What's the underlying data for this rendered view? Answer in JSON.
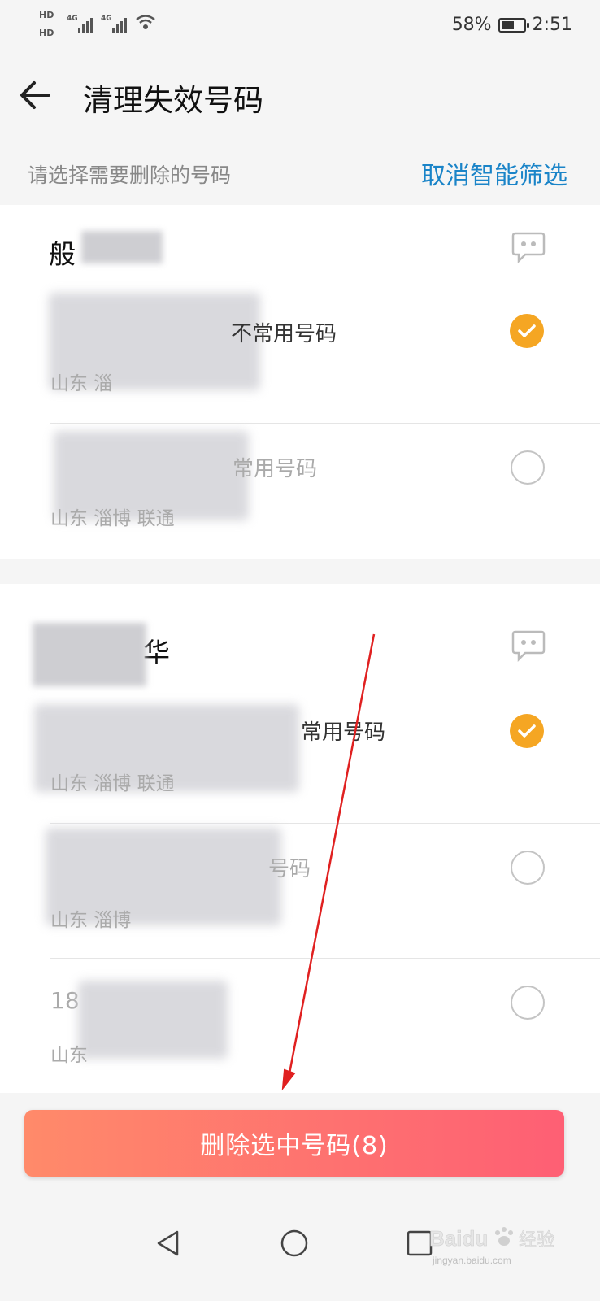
{
  "status_bar": {
    "hd1": "HD",
    "hd2": "HD",
    "net1": "4G",
    "net2": "4G",
    "battery_percent": "58%",
    "battery_level": 0.58,
    "time": "2:51"
  },
  "header": {
    "title": "清理失效号码",
    "subtitle": "请选择需要删除的号码",
    "cancel_filter_label": "取消智能筛选"
  },
  "groups": [
    {
      "name": "般",
      "numbers": [
        {
          "number_suffix": "不常用号码",
          "location": "山东 淄",
          "checked": true
        },
        {
          "number_suffix": "常用号码",
          "location": "山东 淄博 联通",
          "checked": false
        }
      ]
    },
    {
      "name": "华",
      "numbers": [
        {
          "number_suffix": "常用号码",
          "location": "山东 淄博 联通",
          "checked": true
        },
        {
          "number_suffix": "号码",
          "location": "山东 淄博",
          "checked": false
        },
        {
          "number_prefix": "18",
          "location": "山东",
          "checked": false
        }
      ]
    }
  ],
  "bottom": {
    "delete_label": "删除选中号码(8)"
  },
  "watermark": {
    "text_main": "Baidu",
    "text_cn": "经验",
    "text_url": "jingyan.baidu.com"
  },
  "colors": {
    "accent_blue": "#1a84c8",
    "check_orange": "#f5a623",
    "button_gradient_start": "#ff8a6a",
    "button_gradient_end": "#fe5f74",
    "annotation_arrow": "#e02020"
  }
}
